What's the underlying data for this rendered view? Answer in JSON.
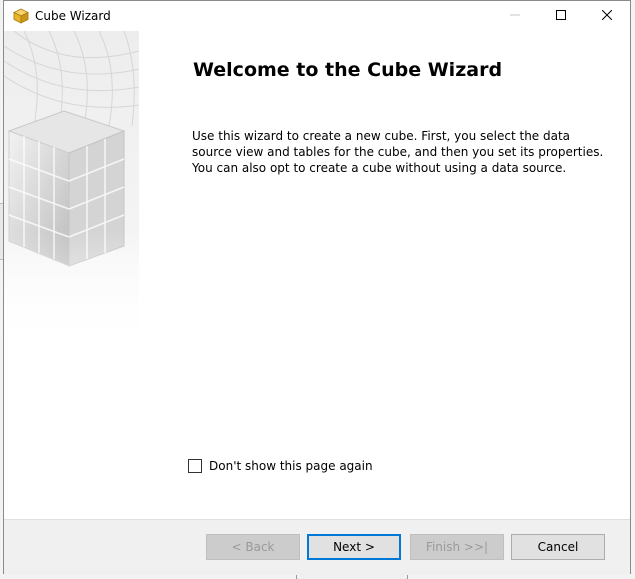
{
  "window": {
    "title": "Cube Wizard",
    "icon": "cube-icon",
    "controls": {
      "minimize": "minimize-icon",
      "maximize": "maximize-icon",
      "close": "close-icon"
    }
  },
  "page": {
    "heading": "Welcome to the Cube Wizard",
    "description": "Use this wizard to create a new cube. First, you select the data source view and tables for the cube, and then you set its properties. You can also opt to create a cube without using a data source.",
    "dont_show_label": "Don't show this page again",
    "dont_show_checked": false
  },
  "footer": {
    "back_label": "< Back",
    "next_label": "Next >",
    "finish_label": "Finish >>|",
    "cancel_label": "Cancel"
  },
  "colors": {
    "accent": "#0078d7",
    "cube_icon": "#e8b52a",
    "footer_bg": "#f0f0f0"
  }
}
